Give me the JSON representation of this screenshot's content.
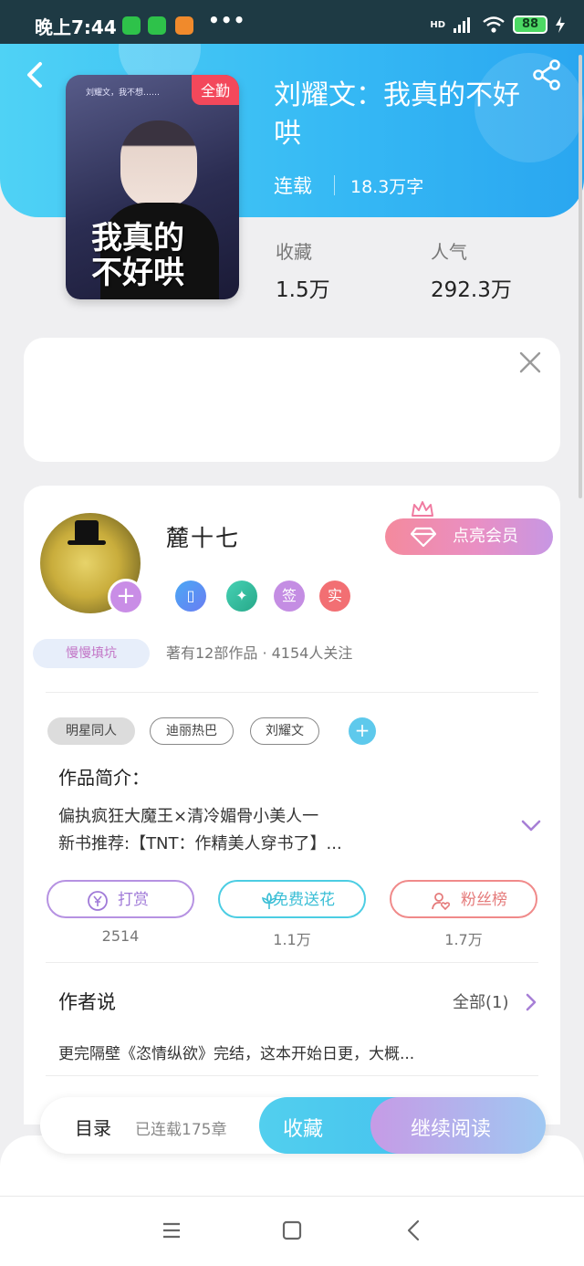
{
  "status_bar": {
    "time": "晚上7:44",
    "dots": "•••",
    "network": "HD",
    "battery": "88"
  },
  "header": {
    "back_icon": "chevron-left-icon",
    "share_icon": "share-icon"
  },
  "book": {
    "cover_badge": "全勤",
    "cover_title_line1": "我真的",
    "cover_title_line2": "不好哄",
    "cover_text": "刘耀文，我不想……",
    "title": "刘耀文：我真的不好哄",
    "status": "连载",
    "word_count": "18.3万字",
    "favorites_label": "收藏",
    "favorites_value": "1.5万",
    "popularity_label": "人气",
    "popularity_value": "292.3万"
  },
  "author": {
    "name": "麓十七",
    "follow_symbol": "+",
    "tag": "慢慢填坑",
    "vip_button": "点亮会员",
    "badges": [
      "签",
      "实"
    ],
    "meta": "著有12部作品 · 4154人关注"
  },
  "tags": {
    "items": [
      "明星同人",
      "迪丽热巴",
      "刘耀文"
    ],
    "add_symbol": "+"
  },
  "intro": {
    "heading": "作品简介：",
    "line1": "偏执疯狂大魔王×清冷媚骨小美人一",
    "line2": "新书推荐:【TNT：作精美人穿书了】..."
  },
  "actions": [
    {
      "label": "打赏",
      "count": "2514",
      "color": "#b07fd8"
    },
    {
      "label": "免费送花",
      "count": "1.1万",
      "color": "#3fc6de"
    },
    {
      "label": "粉丝榜",
      "count": "1.7万",
      "color": "#ee7d7d"
    }
  ],
  "author_says": {
    "heading": "作者说",
    "all_link": "全部(1)",
    "text": "更完隔壁《恣情纵欲》完结，这本开始日更，大概..."
  },
  "bottom_bar": {
    "toc": "目录",
    "chapters": "已连载175章",
    "favorite": "收藏",
    "continue": "继续阅读"
  },
  "colors": {
    "header_start": "#4fd2f5",
    "header_end": "#2aa6f0",
    "vip_start": "#f48a9d",
    "vip_end": "#c797e4"
  }
}
